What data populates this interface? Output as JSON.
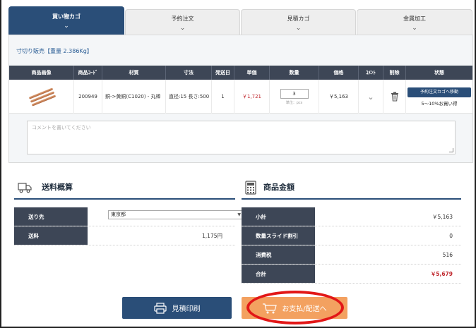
{
  "tabs": [
    {
      "label": "買い物カゴ",
      "active": true
    },
    {
      "label": "予約注文",
      "active": false
    },
    {
      "label": "見積カゴ",
      "active": false
    },
    {
      "label": "金属加工",
      "active": false
    }
  ],
  "subhead": "寸切り販売【重量 2.386Kg】",
  "table": {
    "headers": [
      "商品画像",
      "商品ｺｰﾄﾞ",
      "材質",
      "寸法",
      "発送日",
      "単価",
      "数量",
      "価格",
      "ｺﾒﾝﾄ",
      "削除",
      "状態"
    ],
    "row": {
      "code": "200949",
      "material": "銅->黄銅(C1020) - 丸棒",
      "size": "直径:15 長さ:500",
      "ship": "1",
      "unit_price": "￥1,721",
      "qty": "3",
      "qty_unit": "単位：pcs",
      "price": "￥5,163",
      "status_button": "予約注文カゴへ移動",
      "status_note": "5～10%お買い得"
    }
  },
  "comment_placeholder": "コメントを書いてください",
  "shipping": {
    "title": "送料概算",
    "dest_label": "送り先",
    "dest_value": "東京都",
    "fee_label": "送料",
    "fee_value": "1,175円"
  },
  "totals": {
    "title": "商品金額",
    "subtotal_label": "小計",
    "subtotal_value": "￥5,163",
    "discount_label": "数量スライド割引",
    "discount_value": "0",
    "tax_label": "消費税",
    "tax_value": "516",
    "total_label": "合計",
    "total_value": "￥5,679"
  },
  "buttons": {
    "print": "見積印刷",
    "pay": "お支払/配送へ"
  },
  "colors": {
    "navy": "#2a4e78",
    "header": "#3d4656",
    "orange": "#f3a160",
    "red": "#c0272d",
    "highlight": "#e21717"
  }
}
